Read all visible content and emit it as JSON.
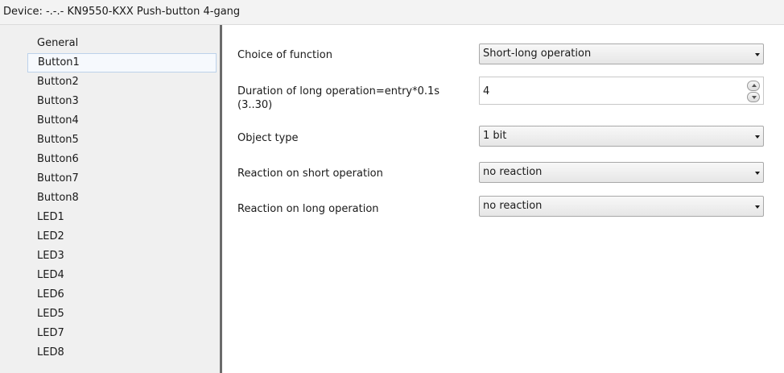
{
  "window": {
    "title": "Device: -.-.-  KN9550-KXX Push-button 4-gang"
  },
  "sidebar": {
    "items": [
      {
        "label": "General",
        "selected": false
      },
      {
        "label": "Button1",
        "selected": true
      },
      {
        "label": "Button2",
        "selected": false
      },
      {
        "label": "Button3",
        "selected": false
      },
      {
        "label": "Button4",
        "selected": false
      },
      {
        "label": "Button5",
        "selected": false
      },
      {
        "label": "Button6",
        "selected": false
      },
      {
        "label": "Button7",
        "selected": false
      },
      {
        "label": "Button8",
        "selected": false
      },
      {
        "label": "LED1",
        "selected": false
      },
      {
        "label": "LED2",
        "selected": false
      },
      {
        "label": "LED3",
        "selected": false
      },
      {
        "label": "LED4",
        "selected": false
      },
      {
        "label": "LED6",
        "selected": false
      },
      {
        "label": "LED5",
        "selected": false
      },
      {
        "label": "LED7",
        "selected": false
      },
      {
        "label": "LED8",
        "selected": false
      }
    ]
  },
  "params": {
    "choice_of_function": {
      "label": "Choice of function",
      "value": "Short-long operation"
    },
    "long_duration": {
      "label_line1": "Duration of long operation=entry*0.1s",
      "label_line2": "(3..30)",
      "value": "4"
    },
    "object_type": {
      "label": "Object type",
      "value": "1 bit"
    },
    "short_reaction": {
      "label": "Reaction on short operation",
      "value": "no reaction"
    },
    "long_reaction": {
      "label": "Reaction on long operation",
      "value": "no reaction"
    }
  },
  "colors": {
    "sidebar_bg": "#f0f0f0",
    "selection_border": "#bcd2ea",
    "splitter": "#6b6b6b"
  },
  "icons": {
    "dropdown": "chevron-down-icon",
    "spin_up": "arrow-up-icon",
    "spin_down": "arrow-down-icon"
  }
}
